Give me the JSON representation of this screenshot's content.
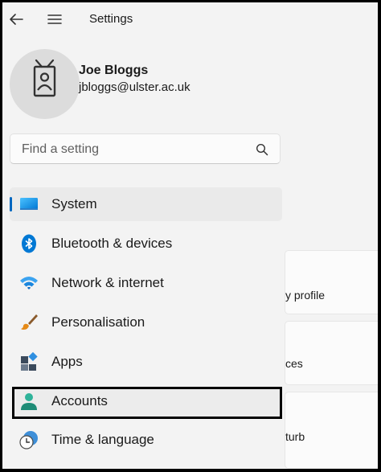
{
  "app": {
    "title": "Settings"
  },
  "profile": {
    "name": "Joe Bloggs",
    "email": "jbloggs@ulster.ac.uk"
  },
  "search": {
    "placeholder": "Find a setting"
  },
  "nav": {
    "items": [
      {
        "label": "System",
        "icon": "monitor-icon",
        "selected": true
      },
      {
        "label": "Bluetooth & devices",
        "icon": "bluetooth-icon"
      },
      {
        "label": "Network & internet",
        "icon": "wifi-icon"
      },
      {
        "label": "Personalisation",
        "icon": "paintbrush-icon"
      },
      {
        "label": "Apps",
        "icon": "apps-icon"
      },
      {
        "label": "Accounts",
        "icon": "person-icon",
        "highlighted": true
      },
      {
        "label": "Time & language",
        "icon": "clock-globe-icon"
      }
    ]
  },
  "right_panel": {
    "cards": [
      {
        "text": "y profile"
      },
      {
        "text": "ces"
      },
      {
        "text": "turb"
      }
    ]
  },
  "colors": {
    "accent": "#0067c0",
    "highlight_border": "#000000"
  }
}
